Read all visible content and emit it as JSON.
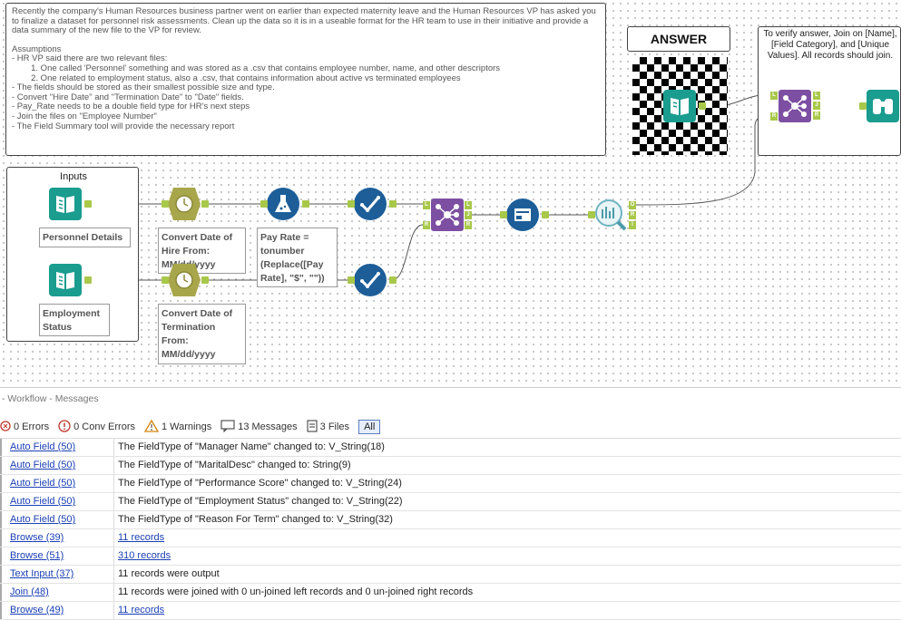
{
  "instructions": {
    "intro": "Recently the company's Human Resources business partner went on earlier than expected maternity leave and the Human Resources VP has asked you to finalize a dataset for personnel risk assessments. Clean up the data so it is in a useable format for the HR team to use in their initiative and provide a data summary of the new file to the VP for review.",
    "assumptions_title": "Assumptions",
    "lines": [
      "- HR VP said there are two relevant files:",
      "        1. One called 'Personnel' something and was stored as a .csv that contains employee number, name, and other descriptors",
      "        2. One related to employment status, also a .csv, that contains information about active vs terminated employees",
      "- The fields should be stored as their smallest possible size and type.",
      "- Convert \"Hire Date\" and \"Termination Date\" to \"Date\" fields.",
      "- Pay_Rate needs to be a double field type for HR's next steps",
      "- Join the files on \"Employee Number\"",
      "- The Field Summary tool will provide the necessary report"
    ]
  },
  "answer_label": "ANSWER",
  "verify": {
    "text": "To verify answer, Join on [Name], [Field Category], and [Unique Values]. All records should join."
  },
  "inputs": {
    "title": "Inputs",
    "personnel_label": "Personnel Details",
    "status_label": "Employment Status"
  },
  "annotations": {
    "convert_hire": "Convert Date of Hire From: MM/dd/yyyy",
    "convert_term": "Convert Date of Termination From: MM/dd/yyyy",
    "pay_rate": "Pay Rate = tonumber (Replace([Pay Rate], \"$\", \"\"))"
  },
  "anchors": {
    "L": "L",
    "J": "J",
    "R": "R",
    "O": "O",
    "I": "I"
  },
  "messages": {
    "header": "- Workflow - Messages",
    "filters": {
      "errors": "0 Errors",
      "conv_errors": "0 Conv Errors",
      "warnings": "1 Warnings",
      "messages": "13 Messages",
      "files": "3 Files",
      "all": "All"
    },
    "rows": [
      {
        "tool": "Auto Field (50)",
        "msg": "The FieldType of \"Manager Name\" changed to: V_String(18)"
      },
      {
        "tool": "Auto Field (50)",
        "msg": "The FieldType of \"MaritalDesc\" changed to: String(9)"
      },
      {
        "tool": "Auto Field (50)",
        "msg": "The FieldType of \"Performance Score\" changed to: V_String(24)"
      },
      {
        "tool": "Auto Field (50)",
        "msg": "The FieldType of \"Employment Status\" changed to: V_String(22)"
      },
      {
        "tool": "Auto Field (50)",
        "msg": "The FieldType of \"Reason For Term\" changed to: V_String(32)"
      },
      {
        "tool": "Browse (39)",
        "msg": "11 records"
      },
      {
        "tool": "Browse (51)",
        "msg": "310 records"
      },
      {
        "tool": "Text Input (37)",
        "msg": "11 records were output"
      },
      {
        "tool": "Join (48)",
        "msg": "11 records were joined with 0 un-joined left records and 0 un-joined right records"
      },
      {
        "tool": "Browse (49)",
        "msg": "11 records"
      }
    ]
  },
  "colors": {
    "input_teal": "#1a9c8f",
    "formula_blue": "#1d5e99",
    "join_purple": "#7d4fa2",
    "anchor_green": "#a8c84a",
    "datetime_olive": "#a8a64a"
  }
}
